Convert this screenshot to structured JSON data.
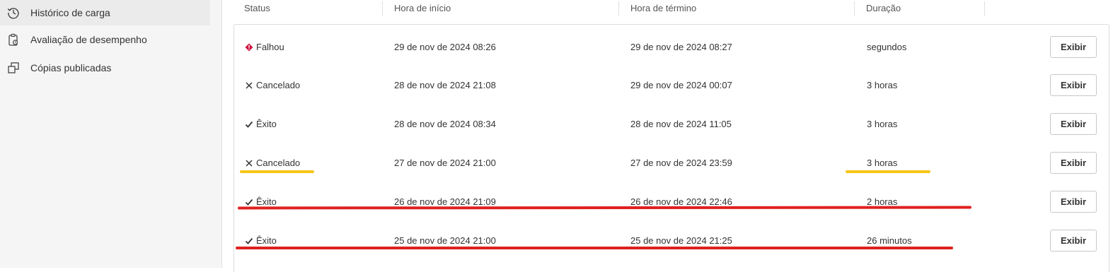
{
  "sidebar": {
    "items": [
      {
        "label": "Histórico de carga",
        "icon": "history-icon",
        "active": true
      },
      {
        "label": "Avaliação de desempenho",
        "icon": "clipboard-icon",
        "active": false
      },
      {
        "label": "Cópias publicadas",
        "icon": "copies-icon",
        "active": false
      }
    ]
  },
  "table": {
    "columns": [
      "Status",
      "Hora de início",
      "Hora de término",
      "Duração"
    ],
    "view_label": "Exibir",
    "rows": [
      {
        "status": "Falhou",
        "status_icon": "error-icon",
        "start": "29 de nov de 2024 08:26",
        "end": "29 de nov de 2024 08:27",
        "duration": "segundos"
      },
      {
        "status": "Cancelado",
        "status_icon": "x-icon",
        "start": "28 de nov de 2024 21:08",
        "end": "29 de nov de 2024 00:07",
        "duration": "3 horas"
      },
      {
        "status": "Êxito",
        "status_icon": "check-icon",
        "start": "28 de nov de 2024 08:34",
        "end": "28 de nov de 2024 11:05",
        "duration": "3 horas"
      },
      {
        "status": "Cancelado",
        "status_icon": "x-icon",
        "start": "27 de nov de 2024 21:00",
        "end": "27 de nov de 2024 23:59",
        "duration": "3 horas"
      },
      {
        "status": "Êxito",
        "status_icon": "check-icon",
        "start": "26 de nov de 2024 21:09",
        "end": "26 de nov de 2024 22:46",
        "duration": "2 horas"
      },
      {
        "status": "Êxito",
        "status_icon": "check-icon",
        "start": "25 de nov de 2024 21:00",
        "end": "25 de nov de 2024 21:25",
        "duration": "26 minutos"
      }
    ]
  },
  "colors": {
    "error": "#d0123f",
    "highlight_yellow": "#f5c518",
    "highlight_red": "#e02020"
  }
}
